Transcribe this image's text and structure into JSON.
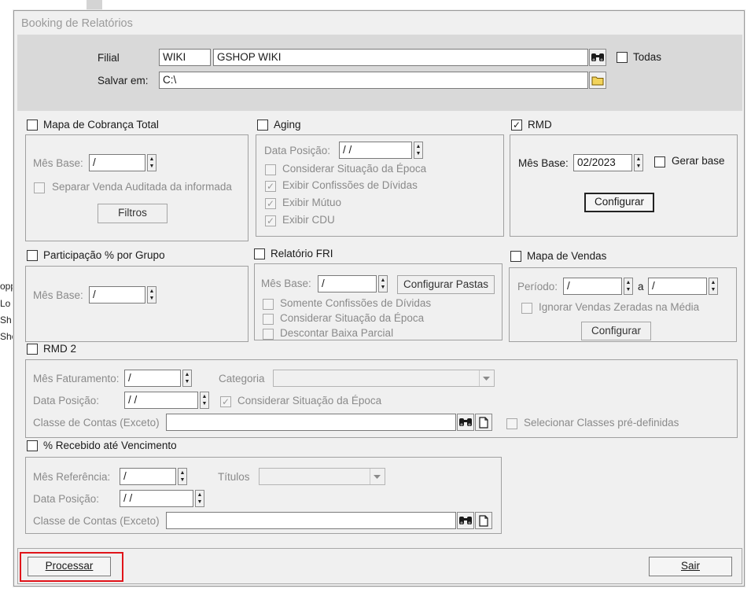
{
  "window": {
    "title": "Booking de Relatórios"
  },
  "background_fragments": [
    "opp",
    "Lo",
    "Sh",
    "Sho"
  ],
  "filial": {
    "label": "Filial",
    "code": "WIKI",
    "name": "GSHOP WIKI",
    "todas_label": "Todas",
    "todas_checked": false
  },
  "salvar": {
    "label": "Salvar em:",
    "path": "C:\\"
  },
  "mapa_cobranca": {
    "title": "Mapa de Cobrança Total",
    "checked": false,
    "mes_base_label": "Mês Base:",
    "mes_base_value": " /",
    "separar_label": "Separar Venda Auditada da informada",
    "filtros_label": "Filtros"
  },
  "aging": {
    "title": "Aging",
    "checked": false,
    "data_posicao_label": "Data Posição:",
    "data_posicao_value": " / /",
    "options": [
      {
        "label": "Considerar Situação da Época",
        "checked": false
      },
      {
        "label": "Exibir Confissões de Dívidas",
        "checked": true
      },
      {
        "label": "Exibir Mútuo",
        "checked": true
      },
      {
        "label": "Exibir CDU",
        "checked": true
      }
    ]
  },
  "rmd": {
    "title": "RMD",
    "checked": true,
    "mes_base_label": "Mês Base:",
    "mes_base_value": "02/2023",
    "gerar_base_label": "Gerar base",
    "configurar_label": "Configurar"
  },
  "participacao": {
    "title": "Participação % por Grupo",
    "checked": false,
    "mes_base_label": "Mês Base:",
    "mes_base_value": " /"
  },
  "relatorio_fri": {
    "title": "Relatório FRI",
    "checked": false,
    "mes_base_label": "Mês Base:",
    "mes_base_value": " /",
    "configurar_pastas_label": "Configurar Pastas",
    "options": [
      {
        "label": "Somente Confissões de Dívidas",
        "checked": false
      },
      {
        "label": "Considerar Situação da Época",
        "checked": false
      },
      {
        "label": "Descontar Baixa Parcial",
        "checked": false
      }
    ]
  },
  "mapa_vendas": {
    "title": "Mapa de Vendas",
    "checked": false,
    "periodo_label": "Período:",
    "periodo_from": " /",
    "periodo_sep": "a",
    "periodo_to": " /",
    "ignorar_label": "Ignorar Vendas Zeradas na Média",
    "configurar_label": "Configurar"
  },
  "rmd2": {
    "title": "RMD 2",
    "checked": false,
    "mes_faturamento_label": "Mês Faturamento:",
    "mes_faturamento_value": " /",
    "categoria_label": "Categoria",
    "categoria_value": "",
    "data_posicao_label": "Data Posição:",
    "data_posicao_value": " / /",
    "considerar_label": "Considerar Situação da Época",
    "considerar_checked": true,
    "classe_label": "Classe de Contas (Exceto)",
    "classe_value": "",
    "selecionar_label": "Selecionar Classes pré-definidas"
  },
  "recebido": {
    "title": "% Recebido até Vencimento",
    "checked": false,
    "mes_referencia_label": "Mês Referência:",
    "mes_referencia_value": " /",
    "titulos_label": "Títulos",
    "titulos_value": "",
    "data_posicao_label": "Data Posição:",
    "data_posicao_value": " / /",
    "classe_label": "Classe de Contas (Exceto)",
    "classe_value": ""
  },
  "footer": {
    "processar_label": "Processar",
    "sair_label": "Sair"
  },
  "colors": {
    "window_bg": "#f0f0f0",
    "top_panel_bg": "#d9d9d9",
    "highlight": "#e0141a",
    "title_text": "#9a9a9a"
  },
  "icons": {
    "search": "binoculars-icon",
    "folder": "folder-icon",
    "new": "new-document-icon"
  }
}
